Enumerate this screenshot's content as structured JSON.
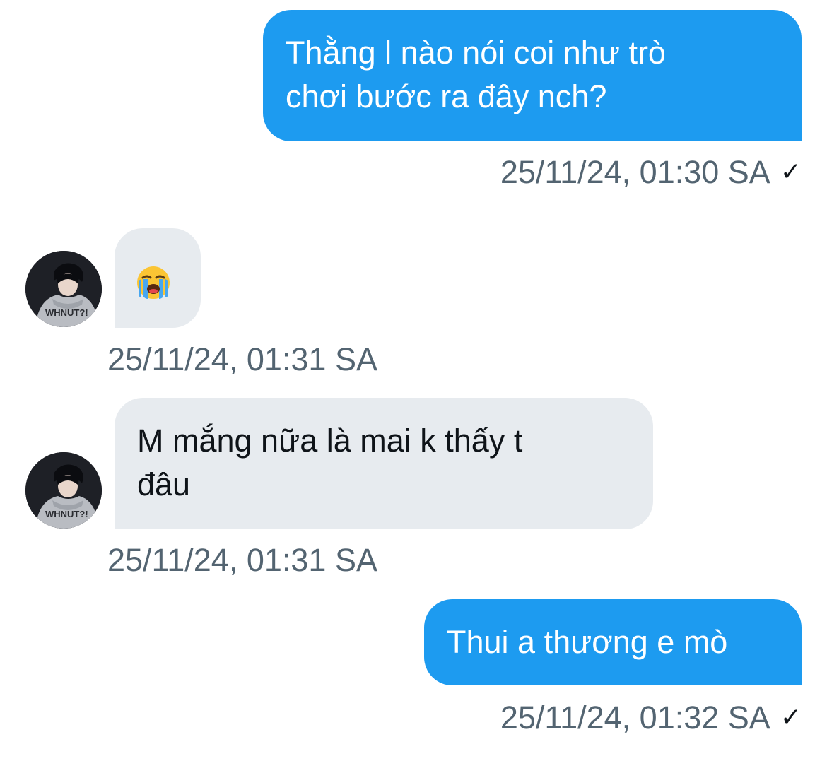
{
  "messages": [
    {
      "direction": "outgoing",
      "lines": [
        "Thằng l nào nói coi như trò",
        "chơi bước ra đây nch?"
      ],
      "timestamp": "25/11/24, 01:30 SA",
      "status_icon": "checkmark-icon",
      "status_glyph": "✓"
    },
    {
      "direction": "incoming",
      "content_type": "emoji",
      "emoji_name": "loudly-crying-face-emoji",
      "timestamp": "25/11/24, 01:31 SA"
    },
    {
      "direction": "incoming",
      "lines": [
        "M mắng nữa là mai k thấy t",
        "đâu"
      ],
      "timestamp": "25/11/24, 01:31 SA"
    },
    {
      "direction": "outgoing",
      "lines": [
        "Thui a thương e mò"
      ],
      "timestamp": "25/11/24, 01:32 SA",
      "status_icon": "checkmark-icon",
      "status_glyph": "✓"
    }
  ],
  "colors": {
    "outgoing_bubble": "#1d9bf0",
    "incoming_bubble": "#e7ebef",
    "timestamp_text": "#536471"
  }
}
